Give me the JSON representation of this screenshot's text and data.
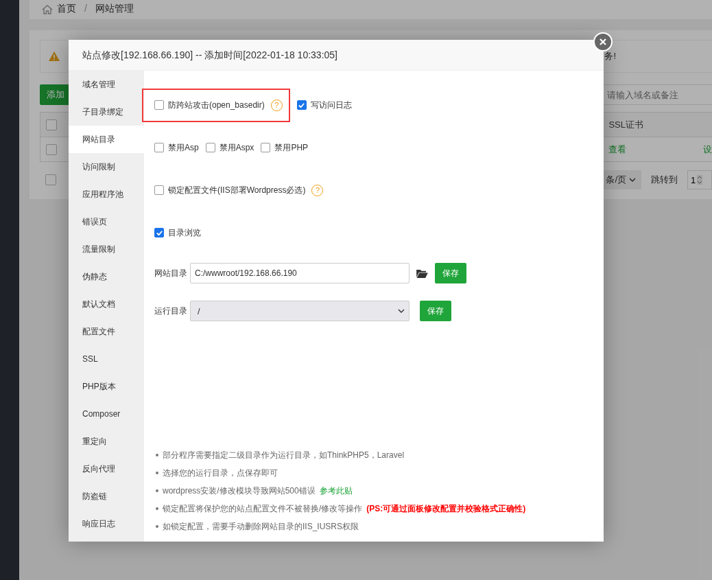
{
  "background": {
    "breadcrumb": [
      {
        "label": "首页"
      },
      {
        "label": "/"
      },
      {
        "label": "网站管理"
      }
    ],
    "notice_text": "务!",
    "add_button": "添加",
    "search": {
      "placeholder": "请输入域名或备注"
    },
    "table": {
      "all_checked": false,
      "columns": [
        "SSL证书"
      ],
      "rows": [
        {
          "checked": false,
          "cells": [
            "查看",
            "设"
          ]
        }
      ]
    },
    "pagination": {
      "select_all_checked": false,
      "page_size": "条/页",
      "jump_label": "跳转到",
      "page": "1"
    }
  },
  "dialog": {
    "title": "站点修改[192.168.66.190] -- 添加时间[2022-01-18 10:33:05]",
    "tabs": [
      {
        "label": "域名管理",
        "selected": false
      },
      {
        "label": "子目录绑定",
        "selected": false
      },
      {
        "label": "网站目录",
        "selected": true
      },
      {
        "label": "访问限制",
        "selected": false
      },
      {
        "label": "应用程序池",
        "selected": false
      },
      {
        "label": "错误页",
        "selected": false
      },
      {
        "label": "流量限制",
        "selected": false
      },
      {
        "label": "伪静态",
        "selected": false
      },
      {
        "label": "默认文档",
        "selected": false
      },
      {
        "label": "配置文件",
        "selected": false
      },
      {
        "label": "SSL",
        "selected": false
      },
      {
        "label": "PHP版本",
        "selected": false
      },
      {
        "label": "Composer",
        "selected": false
      },
      {
        "label": "重定向",
        "selected": false
      },
      {
        "label": "反向代理",
        "selected": false
      },
      {
        "label": "防盗链",
        "selected": false
      },
      {
        "label": "响应日志",
        "selected": false
      }
    ],
    "option_rows": [
      [
        {
          "label": "防跨站攻击(open_basedir)",
          "checked": false,
          "help": "?",
          "highlighted": true
        },
        {
          "label": "写访问日志",
          "checked": true,
          "highlighted": false
        }
      ],
      [
        {
          "label": "禁用Asp",
          "checked": false,
          "highlighted": false
        },
        {
          "label": "禁用Aspx",
          "checked": false,
          "highlighted": false
        },
        {
          "label": "禁用PHP",
          "checked": false,
          "highlighted": false
        }
      ],
      [
        {
          "label": "锁定配置文件(IIS部署Wordpress必选)",
          "checked": false,
          "help": "?",
          "highlighted": false
        }
      ],
      [
        {
          "label": "目录浏览",
          "checked": true,
          "highlighted": false
        }
      ]
    ],
    "fields": [
      {
        "kind": "input",
        "label": "网站目录",
        "value": "C:/wwwroot/192.168.66.190",
        "browse": true,
        "button": "保存"
      },
      {
        "kind": "select",
        "label": "运行目录",
        "value": "/",
        "browse": false,
        "button": "保存"
      }
    ],
    "notes": [
      {
        "text": "部分程序需要指定二级目录作为运行目录，如ThinkPHP5，Laravel"
      },
      {
        "text": "选择您的运行目录，点保存即可"
      },
      {
        "text": "wordpress安装/修改模块导致网站500错误",
        "extra": {
          "kind": "link",
          "text": "参考此贴"
        }
      },
      {
        "text": "锁定配置将保护您的站点配置文件不被替换/修改等操作",
        "extra": {
          "kind": "warning",
          "text": "(PS:可通过面板修改配置并校验格式正确性)"
        }
      },
      {
        "text": "如锁定配置，需要手动删除网站目录的IIS_IUSRS权限"
      }
    ]
  }
}
